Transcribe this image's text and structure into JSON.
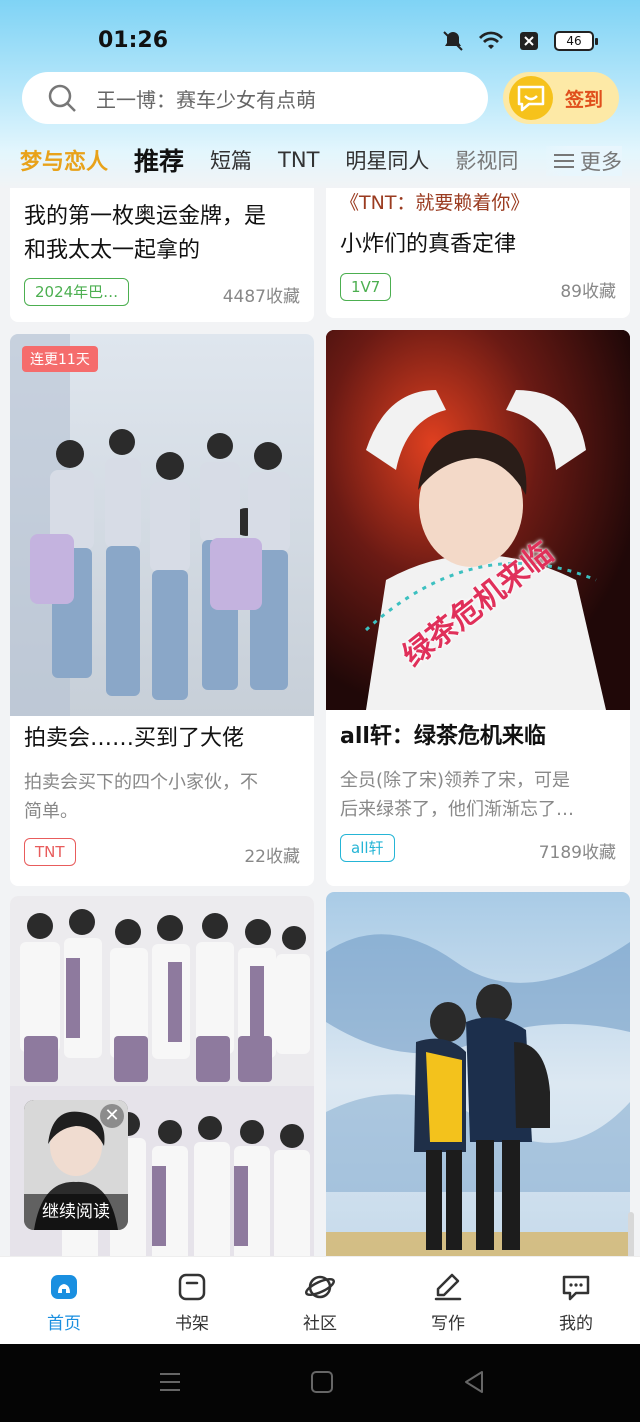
{
  "status_bar": {
    "time": "01:26",
    "battery": "46"
  },
  "search": {
    "placeholder": "王一博：赛车少女有点萌"
  },
  "signin": {
    "label": "签到"
  },
  "tabs": [
    "梦与恋人",
    "推荐",
    "短篇",
    "TNT",
    "明星同人",
    "影视同"
  ],
  "more_label": "更多",
  "cards": [
    {
      "title_lines": [
        "我的第一枚奥运金牌，是",
        "和我太太一起拿的"
      ],
      "tag": "2024年巴…",
      "favorites": "4487收藏"
    },
    {
      "subtitle": "《TNT：就要赖着你》",
      "title": "小炸们的真香定律",
      "tag": "1V7",
      "favorites": "89收藏"
    },
    {
      "badge": "连更11天",
      "title": "拍卖会……买到了大佬",
      "desc_lines": [
        "拍卖会买下的四个小家伙，不",
        "简单。"
      ],
      "tag": "TNT",
      "favorites": "22收藏"
    },
    {
      "title": "all轩：绿茶危机来临",
      "desc_lines": [
        "全员(除了宋)领养了宋，可是",
        "后来绿茶了，他们渐渐忘了…"
      ],
      "tag": "all轩",
      "favorites": "7189收藏",
      "cover_text": "绿茶危机来临"
    },
    {
      "cover": "group-photo"
    },
    {
      "cover": "mountain-photo"
    }
  ],
  "resume_reading": {
    "label": "继续阅读"
  },
  "bottom_nav": [
    {
      "label": "首页",
      "icon": "home-icon",
      "active": true
    },
    {
      "label": "书架",
      "icon": "bookshelf-icon"
    },
    {
      "label": "社区",
      "icon": "community-icon"
    },
    {
      "label": "写作",
      "icon": "write-icon"
    },
    {
      "label": "我的",
      "icon": "profile-icon"
    }
  ],
  "colors": {
    "accent": "#1a8fe0",
    "tab_gold": "#e8a21a",
    "signin": "#e04f1c",
    "tag_green": "#4caf50",
    "tag_red": "#e85c5c",
    "tag_cyan": "#25b5d6"
  }
}
